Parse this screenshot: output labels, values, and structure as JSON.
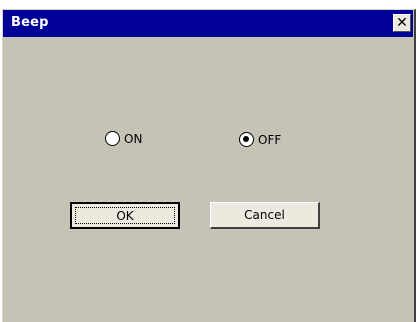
{
  "dialog": {
    "title": "Beep",
    "close_glyph": "✕"
  },
  "options": {
    "on_label": "ON",
    "off_label": "OFF",
    "selected": "OFF"
  },
  "buttons": {
    "ok_label": "OK",
    "cancel_label": "Cancel"
  },
  "colors": {
    "titlebar": "#000099",
    "window_body": "#c6c2b6",
    "button_face": "#ece9df"
  }
}
